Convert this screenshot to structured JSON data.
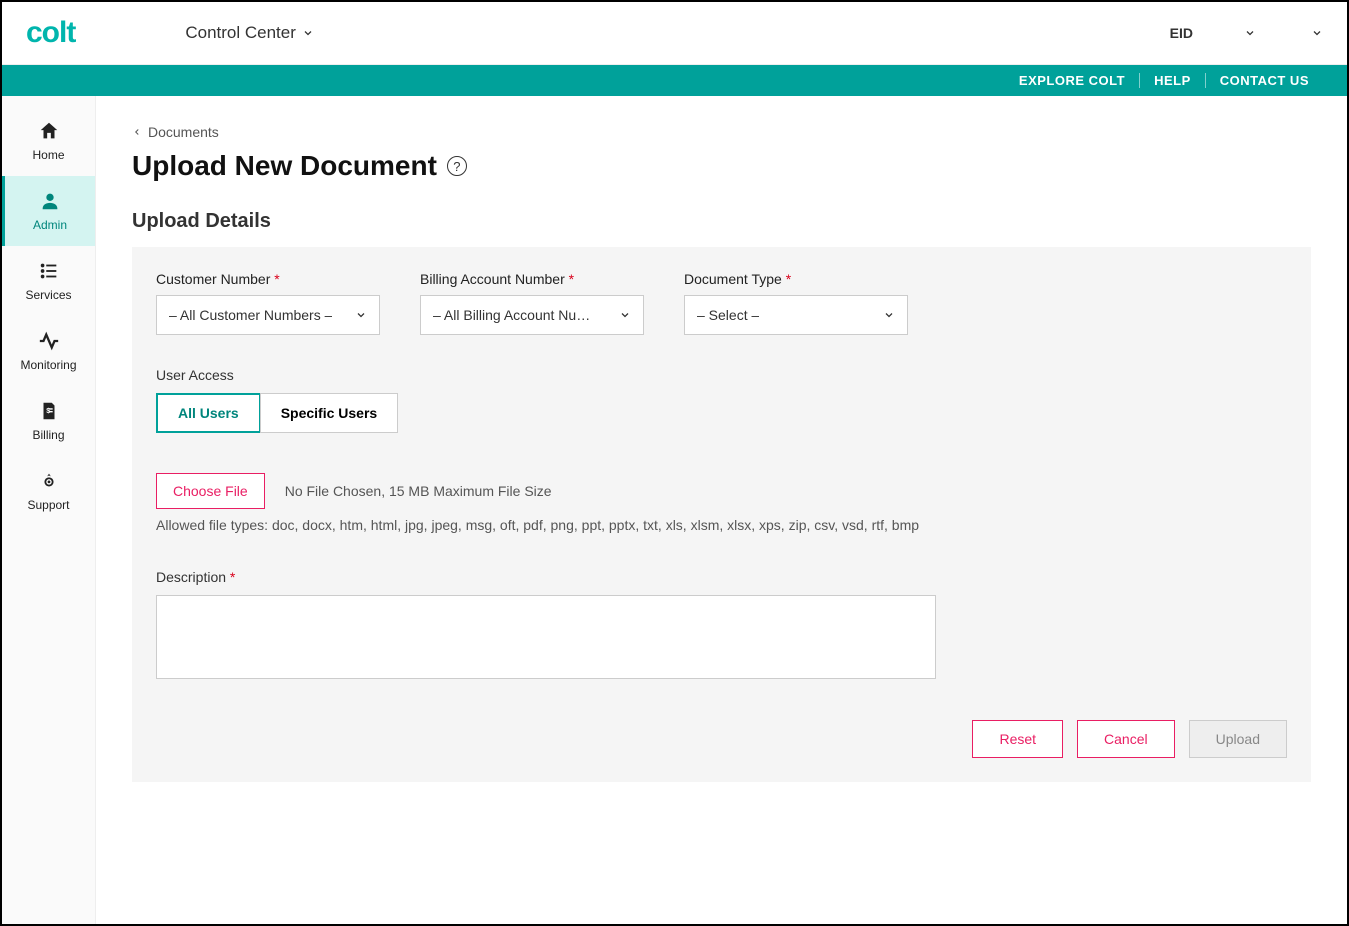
{
  "header": {
    "logo": "colt",
    "app_switcher": "Control Center",
    "eid_label": "EID",
    "eid_value": "          ",
    "user_name": "        "
  },
  "tealbar": {
    "explore": "EXPLORE COLT",
    "help": "HELP",
    "contact": "CONTACT US"
  },
  "sidebar": {
    "items": [
      {
        "label": "Home"
      },
      {
        "label": "Admin"
      },
      {
        "label": "Services"
      },
      {
        "label": "Monitoring"
      },
      {
        "label": "Billing"
      },
      {
        "label": "Support"
      }
    ]
  },
  "breadcrumb": {
    "back": "Documents"
  },
  "page_title": "Upload New Document",
  "section_title": "Upload Details",
  "fields": {
    "customer_number": {
      "label": "Customer Number",
      "value": "– All Customer Numbers –"
    },
    "billing_account": {
      "label": "Billing Account Number",
      "value": "– All Billing Account Nu…"
    },
    "document_type": {
      "label": "Document Type",
      "value": "– Select –"
    }
  },
  "user_access": {
    "label": "User Access",
    "all": "All Users",
    "specific": "Specific Users"
  },
  "file": {
    "choose": "Choose File",
    "status": "No File Chosen, 15 MB Maximum File Size",
    "allowed": "Allowed file types: doc, docx, htm, html, jpg, jpeg, msg, oft, pdf, png, ppt, pptx, txt, xls, xlsm, xlsx, xps, zip, csv, vsd, rtf, bmp"
  },
  "description": {
    "label": "Description"
  },
  "actions": {
    "reset": "Reset",
    "cancel": "Cancel",
    "upload": "Upload"
  }
}
